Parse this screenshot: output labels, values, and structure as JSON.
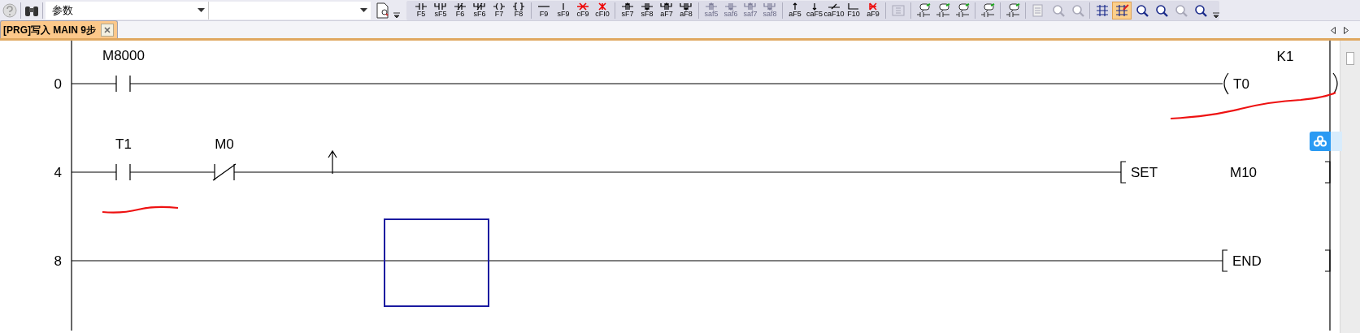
{
  "toolbar": {
    "combo_1": {
      "value": "参数"
    },
    "key_groups": [
      {
        "buttons": [
          {
            "kind": "contact",
            "label": "F5",
            "disabled": false
          },
          {
            "kind": "parallel",
            "label": "sF5",
            "disabled": false
          },
          {
            "kind": "contact_nc",
            "label": "F6",
            "disabled": false
          },
          {
            "kind": "parallel_nc",
            "label": "sF6",
            "disabled": false
          },
          {
            "kind": "coil",
            "label": "F7",
            "disabled": false
          },
          {
            "kind": "func",
            "label": "F8",
            "disabled": false
          }
        ]
      },
      {
        "buttons": [
          {
            "kind": "hline",
            "label": "F9",
            "disabled": false
          },
          {
            "kind": "vline",
            "label": "sF9",
            "disabled": false
          },
          {
            "kind": "hdel",
            "label": "cF9",
            "disabled": false
          },
          {
            "kind": "vdel",
            "label": "cFI0",
            "disabled": false
          }
        ]
      },
      {
        "buttons": [
          {
            "kind": "rise",
            "label": "sF7",
            "disabled": false
          },
          {
            "kind": "fall",
            "label": "sF8",
            "disabled": false
          },
          {
            "kind": "rise_par",
            "label": "aF7",
            "disabled": false
          },
          {
            "kind": "fall_par",
            "label": "aF8",
            "disabled": false
          }
        ]
      },
      {
        "buttons": [
          {
            "kind": "rise",
            "label": "saf5",
            "disabled": true
          },
          {
            "kind": "fall",
            "label": "saf6",
            "disabled": true
          },
          {
            "kind": "rise_par",
            "label": "saf7",
            "disabled": true
          },
          {
            "kind": "fall_par",
            "label": "saf8",
            "disabled": true
          }
        ]
      },
      {
        "buttons": [
          {
            "kind": "up",
            "label": "aF5",
            "disabled": false
          },
          {
            "kind": "down",
            "label": "caF5",
            "disabled": false
          },
          {
            "kind": "invert",
            "label": "caF10",
            "disabled": false
          },
          {
            "kind": "corner",
            "label": "F10",
            "disabled": false
          },
          {
            "kind": "xdel",
            "label": "aF9",
            "disabled": false
          }
        ]
      }
    ],
    "tool_groups": [
      {
        "tools": [
          {
            "kind": "st",
            "disabled": true,
            "selected": false
          }
        ]
      },
      {
        "tools": [
          {
            "kind": "comment",
            "disabled": false,
            "selected": false
          },
          {
            "kind": "comment",
            "disabled": false,
            "selected": false
          },
          {
            "kind": "comment",
            "disabled": false,
            "selected": false
          }
        ]
      },
      {
        "tools": [
          {
            "kind": "comment",
            "disabled": false,
            "selected": false
          }
        ]
      },
      {
        "tools": [
          {
            "kind": "comment",
            "disabled": false,
            "selected": false
          }
        ]
      },
      {
        "tools": [
          {
            "kind": "document",
            "disabled": true,
            "selected": false
          },
          {
            "kind": "magnifier",
            "disabled": true,
            "selected": false
          },
          {
            "kind": "magnifier",
            "disabled": true,
            "selected": false
          }
        ]
      },
      {
        "tools": [
          {
            "kind": "ladder",
            "disabled": false,
            "selected": false
          },
          {
            "kind": "ladder",
            "disabled": false,
            "selected": true
          },
          {
            "kind": "magnifier",
            "disabled": false,
            "selected": false
          },
          {
            "kind": "magnifier",
            "disabled": false,
            "selected": false
          },
          {
            "kind": "magnifier",
            "disabled": true,
            "selected": false
          },
          {
            "kind": "magnifier",
            "disabled": false,
            "selected": false
          }
        ]
      }
    ]
  },
  "tabs": [
    {
      "label": "[PRG]写入 MAIN 9步",
      "selected": true
    }
  ],
  "rungs": [
    {
      "step": "0",
      "cursor": false,
      "elements": [
        {
          "kind": "contact",
          "label": "M8000"
        }
      ],
      "output": {
        "kind": "coil",
        "label": "T0",
        "constant": "K1"
      }
    },
    {
      "step": "4",
      "cursor": false,
      "elements": [
        {
          "kind": "contact",
          "label": "T1"
        },
        {
          "kind": "contact_nc",
          "label": "M0"
        },
        {
          "kind": "rise"
        }
      ],
      "output": {
        "kind": "instruction",
        "label": "SET",
        "operand": "M10"
      }
    },
    {
      "step": "8",
      "cursor": true,
      "output": {
        "kind": "instruction",
        "label": "END"
      }
    }
  ]
}
